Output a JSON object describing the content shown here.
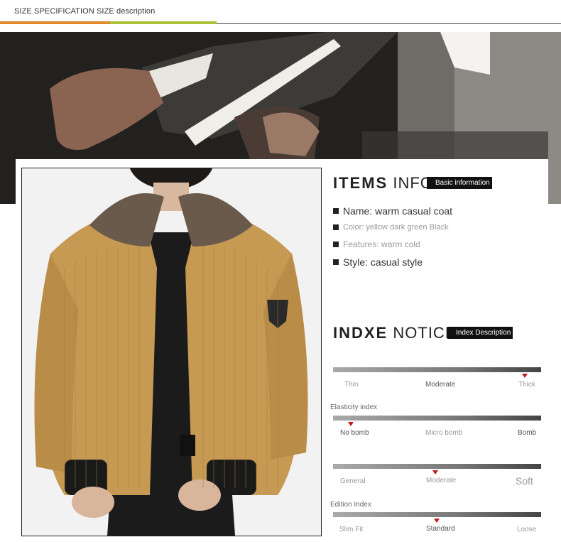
{
  "header": {
    "title": "SIZE SPECIFICATION SIZE description"
  },
  "colors": {
    "accent_orange": "#e08a2c",
    "accent_green": "#a9c23a",
    "marker_red": "#c41a1a"
  },
  "items_info": {
    "heading_bold": "ITEMS",
    "heading_light": "INFO",
    "tag": "Basic information",
    "rows": [
      {
        "text": "Name: warm casual coat"
      },
      {
        "text": "Color: yellow dark green Black"
      },
      {
        "text": "Features: warm cold"
      },
      {
        "text": "Style: casual style"
      }
    ]
  },
  "index_notice": {
    "heading_bold": "INDXE",
    "heading_light": "NOTICE",
    "tag": "Index Description",
    "indices": [
      {
        "label": "",
        "options": [
          "Thin",
          "Moderate",
          "Thick"
        ],
        "selected": "Thick"
      },
      {
        "label": "Elasticity index",
        "options": [
          "No bomb",
          "Micro bomb",
          "Bomb"
        ],
        "selected": "No bomb"
      },
      {
        "label": "",
        "options": [
          "General",
          "Moderate",
          "Soft"
        ],
        "selected": "Moderate"
      },
      {
        "label": "Edition Index",
        "options": [
          "Slim Fit",
          "Standard",
          "Loose"
        ],
        "selected": "Standard"
      }
    ]
  }
}
